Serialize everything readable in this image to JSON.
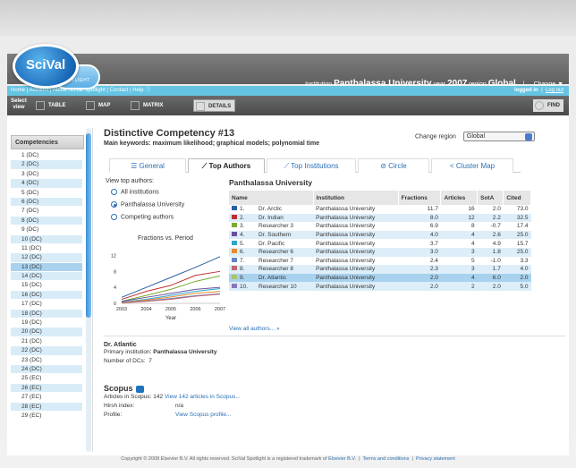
{
  "app": {
    "logo_text": "SciVal",
    "sub_logo": "SPOTLIGHT"
  },
  "header": {
    "institution_label": "Institution",
    "institution": "Panthalassa University",
    "year_label": "year",
    "year": "2007",
    "region_label": "region",
    "region": "Global",
    "change": "Change"
  },
  "nav": {
    "items": [
      "Home",
      "Account",
      "About SciVal Spotlight",
      "Contact",
      "Help"
    ],
    "logged_in": "logged in",
    "logout": "Log out"
  },
  "toolbar": {
    "select_view": "Select view",
    "table": "TABLE",
    "map": "MAP",
    "matrix": "MATRIX",
    "details": "DETAILS",
    "find": "FIND"
  },
  "sidebar": {
    "title": "Competencies",
    "items": [
      "1 (DC)",
      "2 (DC)",
      "3 (DC)",
      "4 (DC)",
      "5 (DC)",
      "6 (DC)",
      "7 (DC)",
      "8 (DC)",
      "9 (DC)",
      "10 (DC)",
      "11 (DC)",
      "12 (DC)",
      "13 (DC)",
      "14 (DC)",
      "15 (DC)",
      "16 (DC)",
      "17 (DC)",
      "18 (DC)",
      "19 (DC)",
      "20 (DC)",
      "21 (DC)",
      "22 (DC)",
      "23 (DC)",
      "24 (DC)",
      "25 (EC)",
      "26 (EC)",
      "27 (EC)",
      "28 (EC)",
      "29 (EC)"
    ],
    "selected_index": 12
  },
  "competency": {
    "title": "Distinctive Competency #13",
    "keywords_label": "Main keywords:",
    "keywords": "maximum likelihood; graphical models; polynomial time",
    "change_region_label": "Change region",
    "region_select": "Global"
  },
  "tabs": [
    "General",
    "Top Authors",
    "Top Institutions",
    "Circle",
    "Cluster Map"
  ],
  "view": {
    "label": "View top authors:",
    "options": [
      "All institutions",
      "Panthalassa University",
      "Competing authors"
    ],
    "selected": 1
  },
  "chart_data": {
    "type": "line",
    "title": "Fractions vs. Period",
    "xlabel": "Year",
    "x": [
      "2003",
      "2004",
      "2005",
      "2006",
      "2007"
    ],
    "yticks": [
      "0",
      "4",
      "8",
      "12"
    ],
    "ylim": [
      0,
      13
    ],
    "series": [
      {
        "color": "#2b5fa8",
        "values": [
          1.5,
          4.0,
          6.5,
          9.0,
          11.7
        ]
      },
      {
        "color": "#c0302f",
        "values": [
          1.0,
          3.0,
          4.5,
          7.0,
          8.0
        ]
      },
      {
        "color": "#7aaa2e",
        "values": [
          0.5,
          2.0,
          3.5,
          5.5,
          6.9
        ]
      },
      {
        "color": "#6b4ea0",
        "values": [
          0.5,
          1.5,
          2.5,
          3.5,
          4.0
        ]
      },
      {
        "color": "#2aa7c9",
        "values": [
          0.3,
          1.0,
          2.0,
          3.0,
          3.7
        ]
      },
      {
        "color": "#e88a2c",
        "values": [
          0.2,
          0.8,
          1.6,
          2.5,
          3.0
        ]
      },
      {
        "color": "#5f86c4",
        "values": [
          0.1,
          0.6,
          1.2,
          1.9,
          2.4
        ]
      },
      {
        "color": "#c46570",
        "values": [
          0.1,
          0.5,
          1.0,
          1.8,
          2.3
        ]
      }
    ]
  },
  "institution_title": "Panthalassa University",
  "authors_table": {
    "headers": [
      "Name",
      "Institution",
      "Fractions",
      "Articles",
      "SotA",
      "Cited"
    ],
    "rows": [
      {
        "rank": "1.",
        "color": "#2b5fa8",
        "name": "Dr. Arctic",
        "institution": "Panthalassa University",
        "fractions": "11.7",
        "articles": "16",
        "sota": "2.0",
        "cited": "73.0"
      },
      {
        "rank": "2.",
        "color": "#c0302f",
        "name": "Dr. Indian",
        "institution": "Panthalassa University",
        "fractions": "8.0",
        "articles": "12",
        "sota": "2.2",
        "cited": "32.5"
      },
      {
        "rank": "3.",
        "color": "#7aaa2e",
        "name": "Researcher 3",
        "institution": "Panthalassa University",
        "fractions": "6.9",
        "articles": "8",
        "sota": "-0.7",
        "cited": "17.4"
      },
      {
        "rank": "4.",
        "color": "#6b4ea0",
        "name": "Dr. Southern",
        "institution": "Panthalassa University",
        "fractions": "4.0",
        "articles": "4",
        "sota": "2.6",
        "cited": "25.0"
      },
      {
        "rank": "5.",
        "color": "#2aa7c9",
        "name": "Dr. Pacific",
        "institution": "Panthalassa University",
        "fractions": "3.7",
        "articles": "4",
        "sota": "4.9",
        "cited": "15.7"
      },
      {
        "rank": "6.",
        "color": "#e88a2c",
        "name": "Researcher 6",
        "institution": "Panthalassa University",
        "fractions": "3.0",
        "articles": "3",
        "sota": "1.8",
        "cited": "25.0"
      },
      {
        "rank": "7.",
        "color": "#5f86c4",
        "name": "Researcher 7",
        "institution": "Panthalassa University",
        "fractions": "2.4",
        "articles": "5",
        "sota": "-1.0",
        "cited": "3.3"
      },
      {
        "rank": "8.",
        "color": "#c46570",
        "name": "Researcher 8",
        "institution": "Panthalassa University",
        "fractions": "2.3",
        "articles": "3",
        "sota": "1.7",
        "cited": "4.0"
      },
      {
        "rank": "9.",
        "color": "#a9c46b",
        "name": "Dr. Atlantic",
        "institution": "Panthalassa University",
        "fractions": "2.0",
        "articles": "4",
        "sota": "6.0",
        "cited": "2.0"
      },
      {
        "rank": "10.",
        "color": "#8a78b5",
        "name": "Researcher 10",
        "institution": "Panthalassa University",
        "fractions": "2.0",
        "articles": "2",
        "sota": "2.0",
        "cited": "5.0"
      }
    ],
    "highlight_index": 8
  },
  "view_all": "View all authors... »",
  "author_detail": {
    "name": "Dr. Atlantic",
    "primary_label": "Primary institution:",
    "primary": "Panthalassa University",
    "dcs_label": "Number of DCs:",
    "dcs": "7"
  },
  "scopus": {
    "title": "Scopus",
    "articles_label": "Articles in Scopus:",
    "articles_count": "142",
    "articles_link": "View 142 articles in Scopus...",
    "hirsh_label": "Hirsh index:",
    "hirsh": "n/a",
    "profile_label": "Profile:",
    "profile_link": "View Scopus profile..."
  },
  "footer": {
    "text": "Copyright © 2008 Elsevier B.V. All rights reserved. SciVal Spotlight is a registered trademark of",
    "elsevier": "Elsevier B.V.",
    "terms": "Terms and conditions",
    "privacy": "Privacy statement"
  }
}
